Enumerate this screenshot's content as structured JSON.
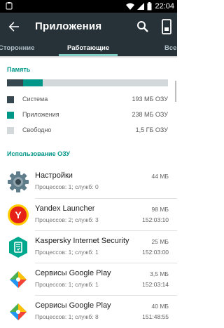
{
  "status_bar": {
    "time": "22:04"
  },
  "app_bar": {
    "title": "Приложения"
  },
  "tabs": [
    {
      "label": "Сторонние"
    },
    {
      "label": "Работающие",
      "active": true
    },
    {
      "label": "Все"
    }
  ],
  "memory": {
    "heading": "Память",
    "system_fraction": 0.1,
    "apps_fraction": 0.12,
    "legend": [
      {
        "label": "Система",
        "value": "193 МБ ОЗУ",
        "color": "#37474f"
      },
      {
        "label": "Приложения",
        "value": "238 МБ ОЗУ",
        "color": "#009688"
      },
      {
        "label": "Свободно",
        "value": "1,5 ГБ ОЗУ",
        "color": "#d3d8db"
      }
    ]
  },
  "ram_usage": {
    "heading": "Использование ОЗУ",
    "apps": [
      {
        "name": "Настройки",
        "sub": "Процессов: 1; служб: 0",
        "size": "44 МБ",
        "time": "",
        "icon": "settings-gear-icon"
      },
      {
        "name": "Yandex Launcher",
        "sub": "Процессов: 2; служб: 3",
        "size": "98 МБ",
        "time": "152:03:10",
        "icon": "yandex-icon"
      },
      {
        "name": "Kaspersky Internet Security",
        "sub": "Процессов: 1; служб: 1",
        "size": "25 МБ",
        "time": "152:03:00",
        "icon": "kaspersky-icon"
      },
      {
        "name": "Сервисы Google Play",
        "sub": "Процессов: 1; служб: 1",
        "size": "3,5 МБ",
        "time": "152:03:14",
        "icon": "google-play-services-icon"
      },
      {
        "name": "Сервисы Google Play",
        "sub": "Процессов: 1; служб: 8",
        "size": "40 МБ",
        "time": "151:48:55",
        "icon": "google-play-services-icon"
      }
    ]
  }
}
